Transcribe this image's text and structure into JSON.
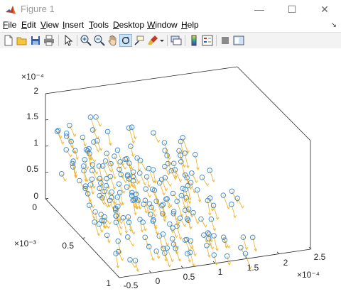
{
  "window": {
    "title": "Figure 1",
    "minimize_glyph": "—",
    "maximize_glyph": "☐",
    "close_glyph": "✕"
  },
  "menu": {
    "items": [
      {
        "label": "File",
        "mnemonic": "F",
        "rest": "ile"
      },
      {
        "label": "Edit",
        "mnemonic": "E",
        "rest": "dit"
      },
      {
        "label": "View",
        "mnemonic": "V",
        "rest": "iew"
      },
      {
        "label": "Insert",
        "mnemonic": "I",
        "rest": "nsert"
      },
      {
        "label": "Tools",
        "mnemonic": "T",
        "rest": "ools"
      },
      {
        "label": "Desktop",
        "mnemonic": "D",
        "rest": "esktop"
      },
      {
        "label": "Window",
        "mnemonic": "W",
        "rest": "indow"
      },
      {
        "label": "Help",
        "mnemonic": "H",
        "rest": "elp"
      }
    ],
    "overflow_glyph": "↘"
  },
  "toolbar": {
    "buttons": [
      "new-figure-icon",
      "open-file-icon",
      "save-icon",
      "print-icon",
      "select-arrow-icon",
      "zoom-in-icon",
      "zoom-out-icon",
      "pan-hand-icon",
      "rotate-3d-icon",
      "data-cursor-icon",
      "brush-icon",
      "brush-dropdown-icon",
      "link-plot-icon",
      "colorbar-icon",
      "legend-icon",
      "hide-plot-tools-icon",
      "show-plot-tools-icon"
    ],
    "active": "rotate-3d-icon"
  },
  "chart_data": {
    "type": "scatter",
    "subtype": "quiver3 with circle markers (3D)",
    "marker_color": "#3a87c9",
    "arrow_color": "#f0b020",
    "axes": {
      "x": {
        "ticks": [
          "-0.5",
          "0",
          "0.5",
          "1",
          "1.5",
          "2",
          "2.5"
        ],
        "multiplier": "×10⁻⁴",
        "range": [
          -0.5,
          2.5
        ]
      },
      "y": {
        "ticks": [
          "0",
          "0.5",
          "1"
        ],
        "multiplier": "×10⁻³",
        "range": [
          0,
          1
        ]
      },
      "z": {
        "ticks": [
          "0",
          "0.5",
          "1",
          "1.5",
          "2"
        ],
        "multiplier": "×10⁻⁴",
        "range": [
          0,
          2
        ]
      }
    },
    "box": true,
    "grid": false
  }
}
